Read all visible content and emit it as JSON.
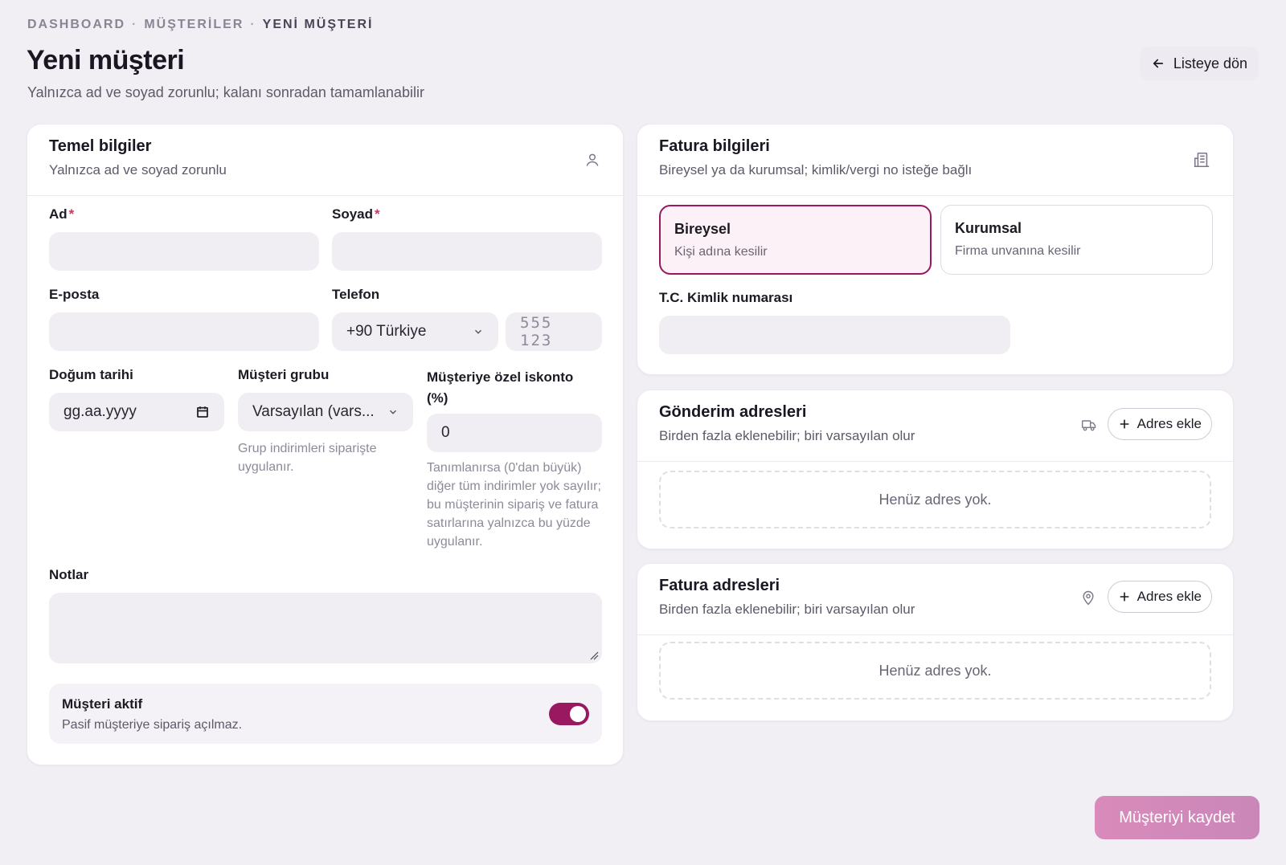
{
  "breadcrumb": {
    "items": [
      "DASHBOARD",
      "MÜŞTERİLER",
      "YENİ MÜŞTERİ"
    ],
    "separator": "·"
  },
  "header": {
    "title": "Yeni müşteri",
    "subtitle": "Yalnızca ad ve soyad zorunlu; kalanı sonradan tamamlanabilir",
    "back_label": "Listeye dön"
  },
  "basic": {
    "title": "Temel bilgiler",
    "subtitle": "Yalnızca ad ve soyad zorunlu",
    "icon": "user-icon",
    "first_name_label": "Ad",
    "last_name_label": "Soyad",
    "required_mark": "*",
    "email_label": "E-posta",
    "phone_label": "Telefon",
    "phone_country": "+90 Türkiye",
    "phone_placeholder": "555 123",
    "birth_label": "Doğum tarihi",
    "birth_placeholder": "gg.aa.yyyy",
    "group_label": "Müşteri grubu",
    "group_value": "Varsayılan (vars...",
    "group_hint": "Grup indirimleri siparişte uygulanır.",
    "discount_label": "Müşteriye özel iskonto (%)",
    "discount_value": "0",
    "discount_hint": "Tanımlanırsa (0'dan büyük) diğer tüm indirimler yok sayılır; bu müşterinin sipariş ve fatura satırlarına yalnızca bu yüzde uygulanır.",
    "notes_label": "Notlar",
    "active_title": "Müşteri aktif",
    "active_sub": "Pasif müşteriye sipariş açılmaz.",
    "active": true
  },
  "billing": {
    "title": "Fatura bilgileri",
    "subtitle": "Bireysel ya da kurumsal; kimlik/vergi no isteğe bağlı",
    "icon": "building-icon",
    "individual_title": "Bireysel",
    "individual_sub": "Kişi adına kesilir",
    "corporate_title": "Kurumsal",
    "corporate_sub": "Firma unvanına kesilir",
    "selected": "Bireysel",
    "id_label": "T.C. Kimlik numarası"
  },
  "shipping_addresses": {
    "title": "Gönderim adresleri",
    "subtitle": "Birden fazla eklenebilir; biri varsayılan olur",
    "icon": "truck-icon",
    "add_label": "Adres ekle",
    "empty_text": "Henüz adres yok."
  },
  "invoice_addresses": {
    "title": "Fatura adresleri",
    "subtitle": "Birden fazla eklenebilir; biri varsayılan olur",
    "icon": "map-pin-icon",
    "add_label": "Adres ekle",
    "empty_text": "Henüz adres yok."
  },
  "footer": {
    "save_label": "Müşteriyi kaydet"
  },
  "colors": {
    "accent": "#9a1860",
    "save_gradient_start": "#d98bbb",
    "background": "#f1eff4"
  }
}
